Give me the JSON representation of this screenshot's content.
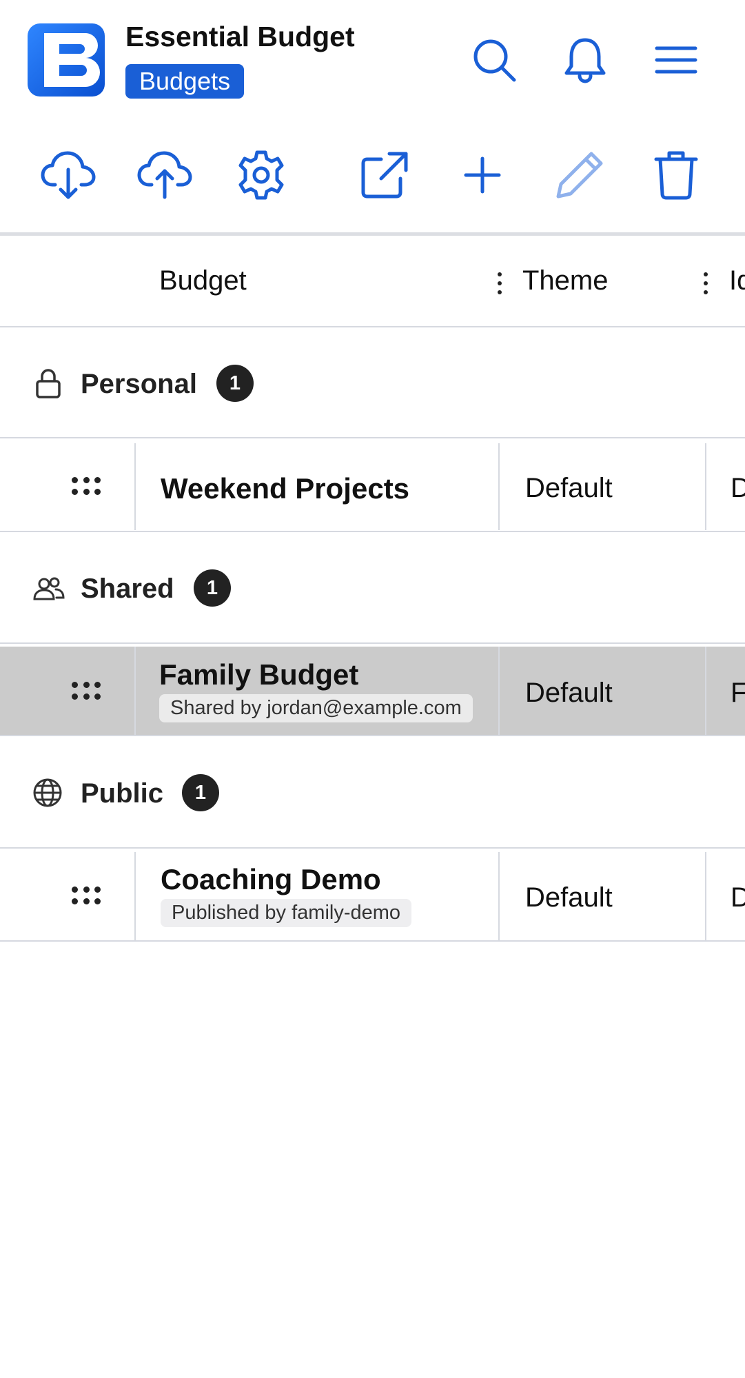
{
  "app": {
    "title": "Essential Budget",
    "section_badge": "Budgets"
  },
  "header_icons": [
    "search-icon",
    "bell-icon",
    "menu-icon"
  ],
  "toolbar_icons": [
    "cloud-download-icon",
    "cloud-upload-icon",
    "gear-icon",
    "external-link-icon",
    "plus-icon",
    "pencil-icon",
    "trash-icon"
  ],
  "table": {
    "columns": [
      "Budget",
      "Theme",
      "Id"
    ],
    "groups": [
      {
        "icon": "lock-icon",
        "label": "Personal",
        "count": "1",
        "rows": [
          {
            "name": "Weekend Projects",
            "subtitle": "",
            "theme": "Default",
            "third": "D"
          }
        ]
      },
      {
        "icon": "users-icon",
        "label": "Shared",
        "count": "1",
        "rows": [
          {
            "name": "Family Budget",
            "subtitle": "Shared by jordan@example.com",
            "theme": "Default",
            "third": "F",
            "selected": true
          }
        ]
      },
      {
        "icon": "globe-icon",
        "label": "Public",
        "count": "1",
        "rows": [
          {
            "name": "Coaching Demo",
            "subtitle": "Published by family-demo",
            "theme": "Default",
            "third": "D"
          }
        ]
      }
    ]
  },
  "colors": {
    "accent": "#1a5fd6",
    "selected_row": "#cbcbcb",
    "divider": "#d6d9e0",
    "count_badge": "#222222"
  }
}
